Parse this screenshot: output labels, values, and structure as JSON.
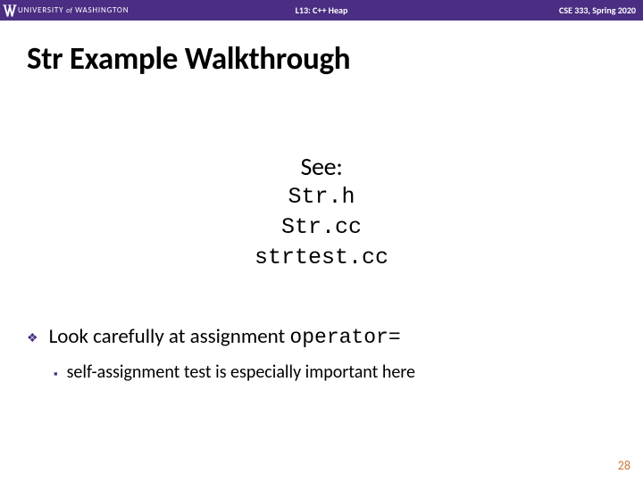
{
  "header": {
    "university_prefix": "UNIVERSITY",
    "university_of": "of",
    "university_name": "WASHINGTON",
    "lecture": "L13: C++ Heap",
    "course": "CSE 333, Spring 2020"
  },
  "title": "Str Example Walkthrough",
  "see": {
    "label": "See:",
    "files": [
      "Str.h",
      "Str.cc",
      "strtest.cc"
    ]
  },
  "bullets": {
    "b1_pre": "Look carefully at assignment ",
    "b1_mono": "operator=",
    "b2": "self-assignment test is especially important here"
  },
  "page": "28"
}
